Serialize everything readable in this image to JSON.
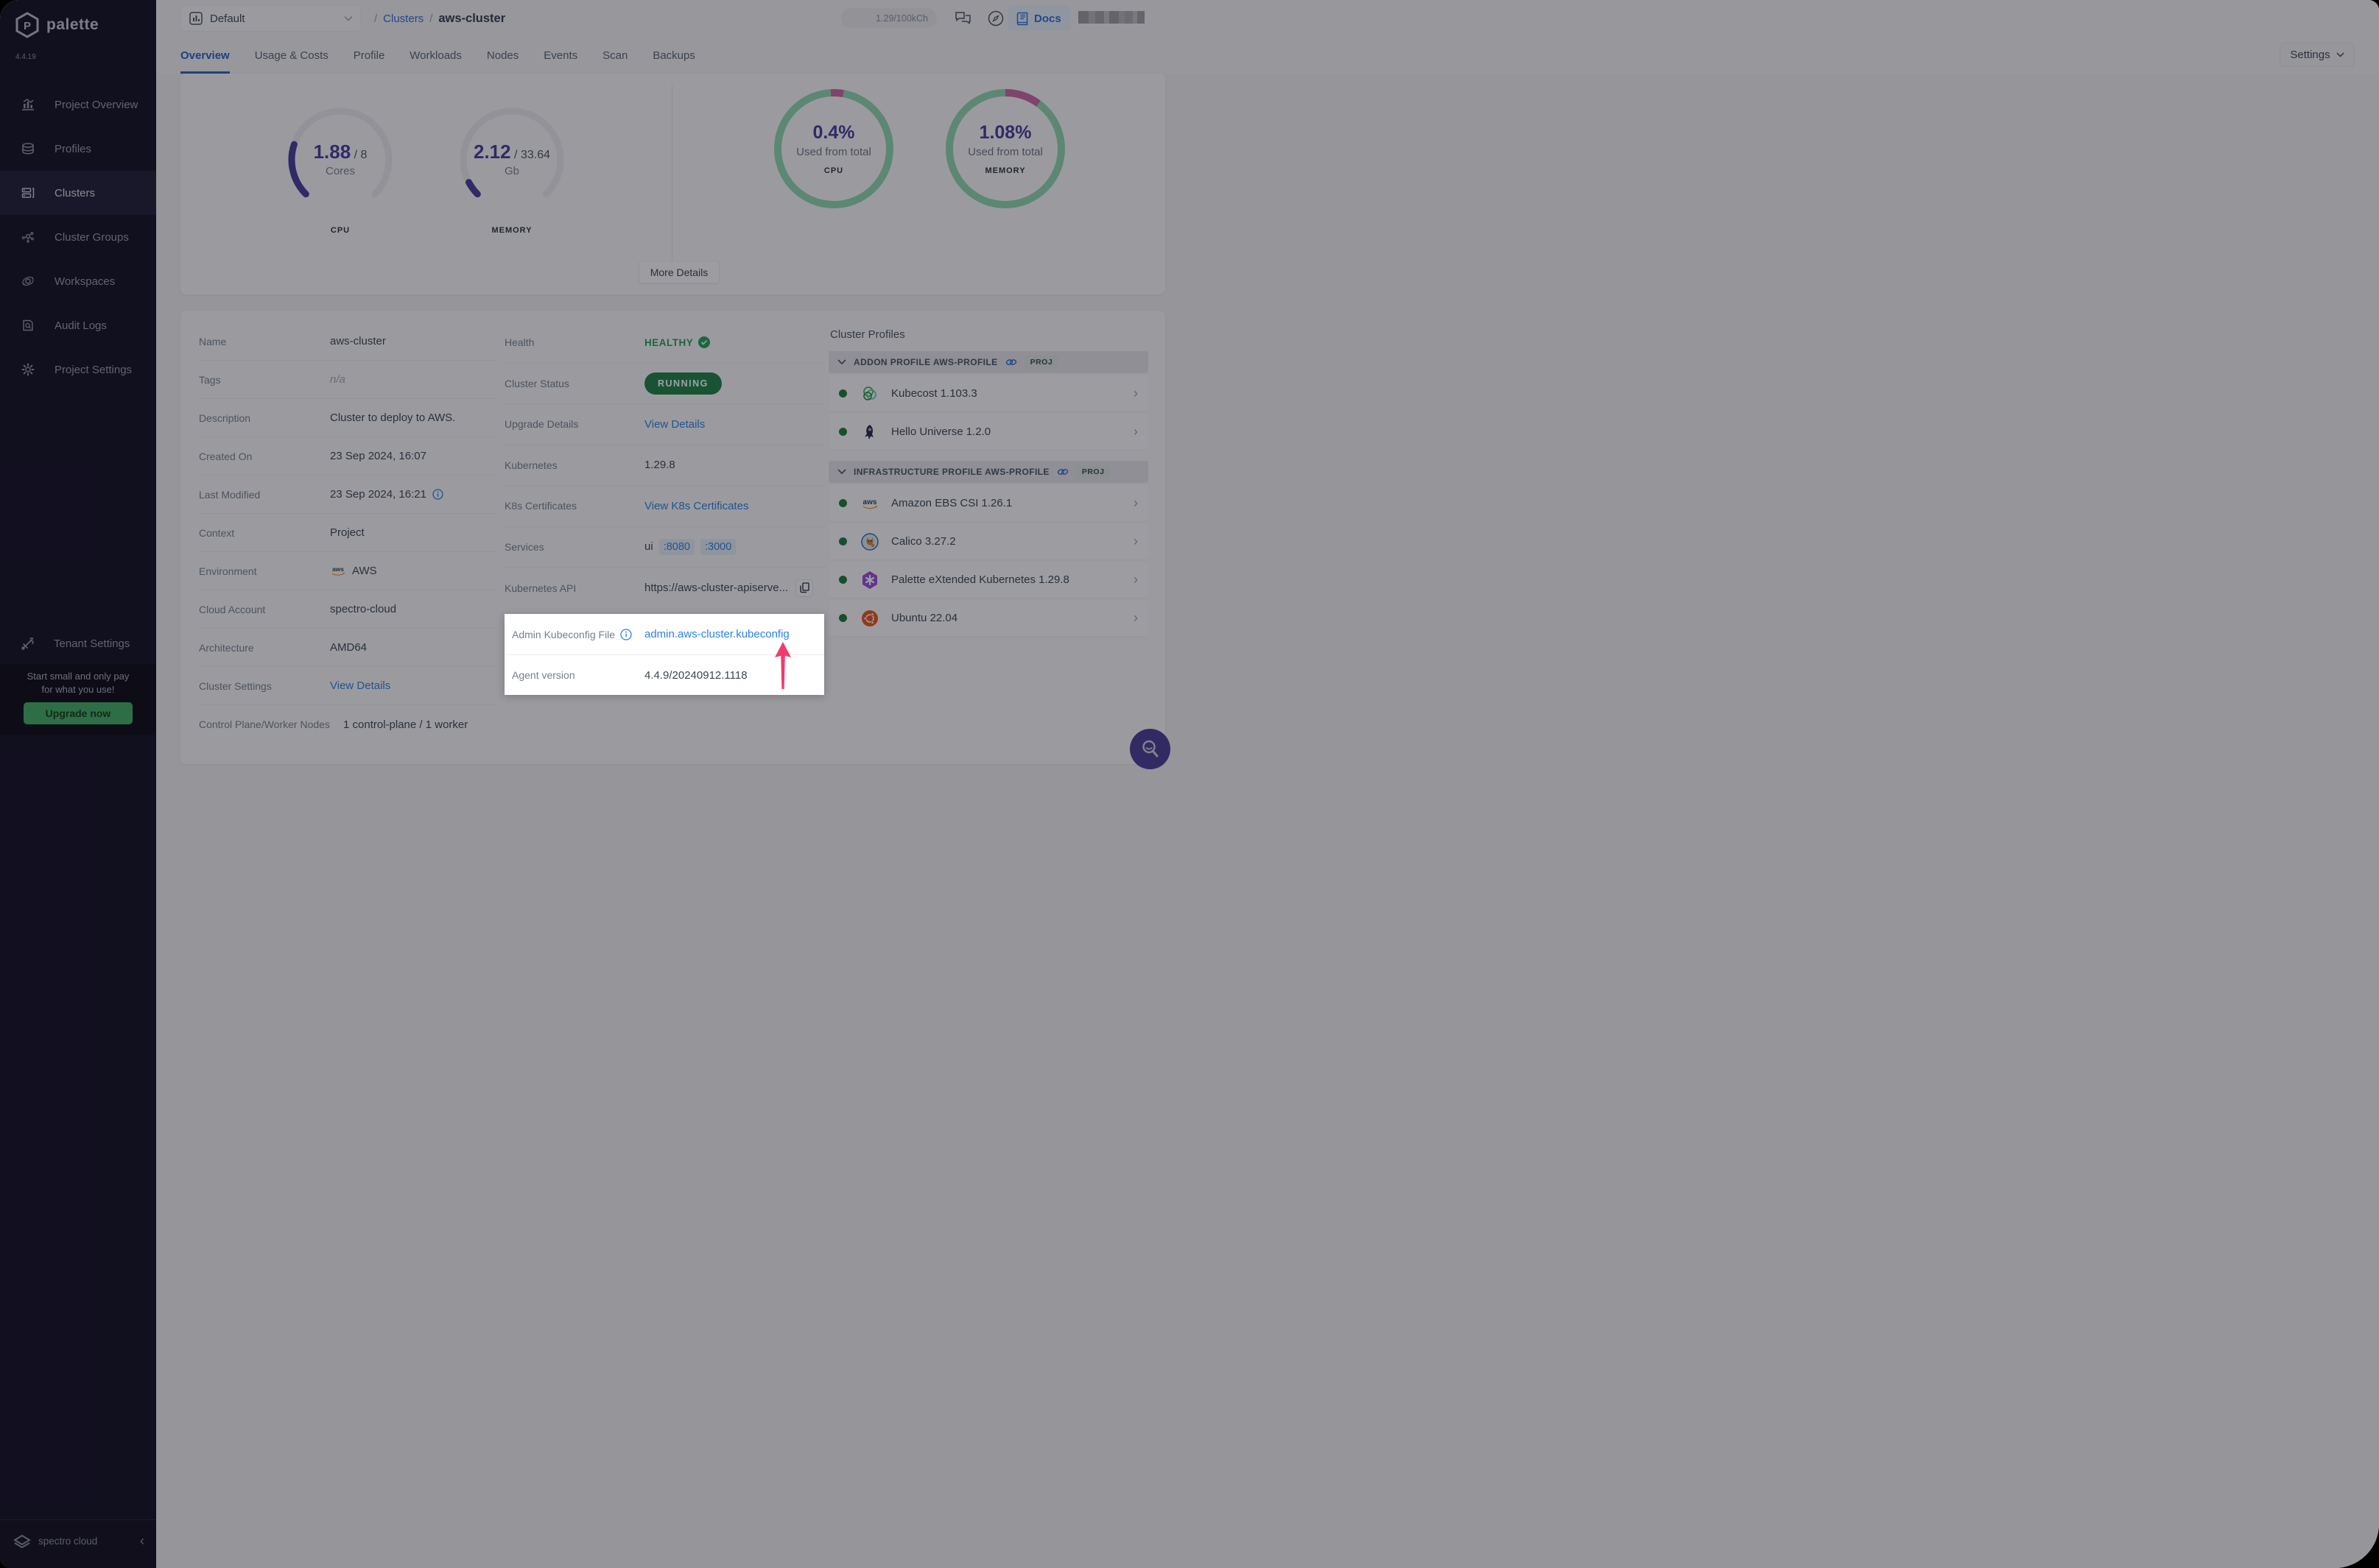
{
  "app": {
    "brand": "palette",
    "version": "4.4.19",
    "footer_brand": "spectro cloud"
  },
  "topbar": {
    "project_selector": "Default",
    "breadcrumb": {
      "sep": "/",
      "section": "Clusters",
      "current": "aws-cluster"
    },
    "usage_pill": "1.29/100kCh",
    "docs_label": "Docs"
  },
  "tabs": {
    "items": [
      "Overview",
      "Usage & Costs",
      "Profile",
      "Workloads",
      "Nodes",
      "Events",
      "Scan",
      "Backups"
    ],
    "settings_button": "Settings"
  },
  "sidebar": {
    "items": [
      "Project Overview",
      "Profiles",
      "Clusters",
      "Cluster Groups",
      "Workspaces",
      "Audit Logs",
      "Project Settings"
    ],
    "tenant": "Tenant Settings",
    "promo_line1": "Start small and only pay",
    "promo_line2": "for what you use!",
    "upgrade_button": "Upgrade now"
  },
  "metrics": {
    "cpu_gauge": {
      "used": "1.88",
      "sep": " / ",
      "total": "8",
      "unit": "Cores",
      "label": "CPU"
    },
    "mem_gauge": {
      "used": "2.12",
      "sep": " / ",
      "total": "33.64",
      "unit": "Gb",
      "label": "MEMORY"
    },
    "cpu_donut": {
      "pct": "0.4%",
      "caption": "Used from total",
      "label": "CPU"
    },
    "mem_donut": {
      "pct": "1.08%",
      "caption": "Used from total",
      "label": "MEMORY"
    },
    "more_details": "More Details"
  },
  "details_left": {
    "rows": [
      {
        "label": "Name",
        "value": "aws-cluster"
      },
      {
        "label": "Tags",
        "value": "n/a"
      },
      {
        "label": "Description",
        "value": "Cluster to deploy to AWS."
      },
      {
        "label": "Created On",
        "value": "23 Sep 2024, 16:07"
      },
      {
        "label": "Last Modified",
        "value": "23 Sep 2024, 16:21"
      },
      {
        "label": "Context",
        "value": "Project"
      },
      {
        "label": "Environment",
        "value": "AWS"
      },
      {
        "label": "Cloud Account",
        "value": "spectro-cloud"
      },
      {
        "label": "Architecture",
        "value": "AMD64"
      },
      {
        "label": "Cluster Settings",
        "value": "View Details"
      },
      {
        "label": "Control Plane/Worker Nodes",
        "value": "1 control-plane / 1 worker"
      }
    ]
  },
  "details_mid": {
    "rows": [
      {
        "label": "Health",
        "value": "HEALTHY"
      },
      {
        "label": "Cluster Status",
        "value": "RUNNING"
      },
      {
        "label": "Upgrade Details",
        "value": "View Details"
      },
      {
        "label": "Kubernetes",
        "value": "1.29.8"
      },
      {
        "label": "K8s Certificates",
        "value": "View K8s Certificates"
      },
      {
        "label": "Services",
        "value": "ui",
        "port1": ":8080",
        "port2": ":3000"
      },
      {
        "label": "Kubernetes API",
        "value": "https://aws-cluster-apiserve..."
      }
    ]
  },
  "spotlight": {
    "rows": [
      {
        "label": "Admin Kubeconfig File",
        "value": "admin.aws-cluster.kubeconfig"
      },
      {
        "label": "Agent version",
        "value": "4.4.9/20240912.1118"
      }
    ]
  },
  "cluster_profiles": {
    "title": "Cluster Profiles",
    "groups": [
      {
        "header": "ADDON PROFILE AWS-PROFILE",
        "badge": "PROJ",
        "items": [
          {
            "name": "Kubecost 1.103.3"
          },
          {
            "name": "Hello Universe 1.2.0"
          }
        ]
      },
      {
        "header": "INFRASTRUCTURE PROFILE AWS-PROFILE",
        "badge": "PROJ",
        "items": [
          {
            "name": "Amazon EBS CSI 1.26.1"
          },
          {
            "name": "Calico 3.27.2"
          },
          {
            "name": "Palette eXtended Kubernetes 1.29.8"
          },
          {
            "name": "Ubuntu 22.04"
          }
        ]
      }
    ]
  },
  "colors": {
    "accent_blue": "#2f6fd9",
    "healthy_green": "#27a15f",
    "running_green": "#1f8347",
    "gauge_purple": "#463c9c",
    "donut_green": "#8fd8b2",
    "donut_pink": "#cb66a4",
    "arrow_pink": "#f23a6e",
    "upgrade_green": "#43ae66",
    "fab_purple": "#4a3f96"
  }
}
